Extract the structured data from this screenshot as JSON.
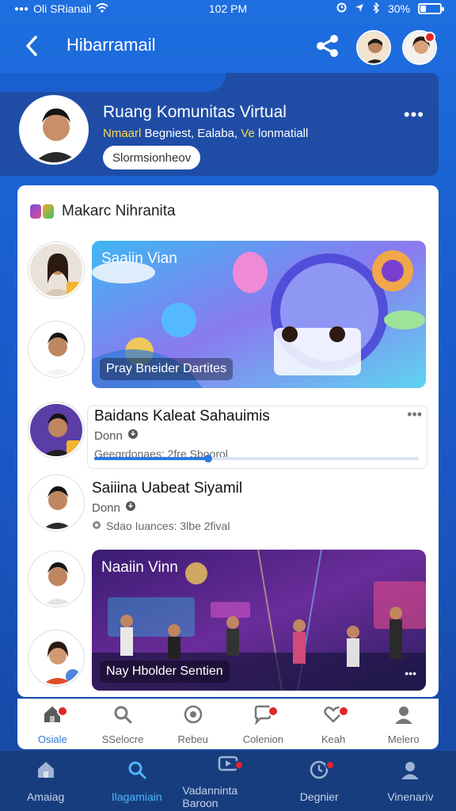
{
  "status_bar": {
    "carrier": "Oli SRianail",
    "time": "102 PM",
    "battery": "30%",
    "battery_level": 0.3
  },
  "header": {
    "back_icon": "chevron-left-icon",
    "title": "Hibarramail",
    "share_icon": "share-icon"
  },
  "community": {
    "title": "Ruang Komunitas Virtual",
    "subtitle_part1": "Nmaarl",
    "subtitle_part2": "Begniest, Ealaba,",
    "subtitle_part3": "Ve",
    "subtitle_part4": "lonmatiall",
    "pill": "Slormsionheov",
    "more": "•••"
  },
  "feed": {
    "header": "Makarc Nihranita",
    "media1": {
      "title": "Saaiin Vian",
      "caption": "Pray Bneider Dartites"
    },
    "post1": {
      "title": "Baidans Kaleat Sahauimis",
      "meta": "Donn",
      "sub": "Geegrdonaes: 2fre Sboorol",
      "more": "•••",
      "progress": 0.35
    },
    "post2": {
      "title": "Saiiina Uabeat Siyamil",
      "meta": "Donn",
      "sub": "Sdao Iuances: 3lbe 2fival"
    },
    "media2": {
      "title": "Naaiin Vinn",
      "caption": "Nay Hbolder Sentien",
      "more": "•••"
    }
  },
  "tabs": [
    {
      "label": "Osiale",
      "icon": "home-icon",
      "active": true,
      "badge": true
    },
    {
      "label": "SSelocre",
      "icon": "search-icon",
      "active": false,
      "badge": false
    },
    {
      "label": "Rebeu",
      "icon": "camera-icon",
      "active": false,
      "badge": false
    },
    {
      "label": "Colenion",
      "icon": "chat-icon",
      "active": false,
      "badge": true
    },
    {
      "label": "Keah",
      "icon": "heart-icon",
      "active": false,
      "badge": true
    },
    {
      "label": "Melero",
      "icon": "profile-icon",
      "active": false,
      "badge": false
    }
  ],
  "bottom_nav": [
    {
      "label": "Amaiag",
      "icon": "home-icon",
      "active": false,
      "badge": false
    },
    {
      "label": "Ilagamiain",
      "icon": "search-icon",
      "active": true,
      "badge": false
    },
    {
      "label": "Vadanninta Baroon",
      "icon": "video-icon",
      "active": false,
      "badge": true
    },
    {
      "label": "Degnier",
      "icon": "clock-icon",
      "active": false,
      "badge": true
    },
    {
      "label": "Vinenariv",
      "icon": "profile-icon",
      "active": false,
      "badge": false
    }
  ]
}
